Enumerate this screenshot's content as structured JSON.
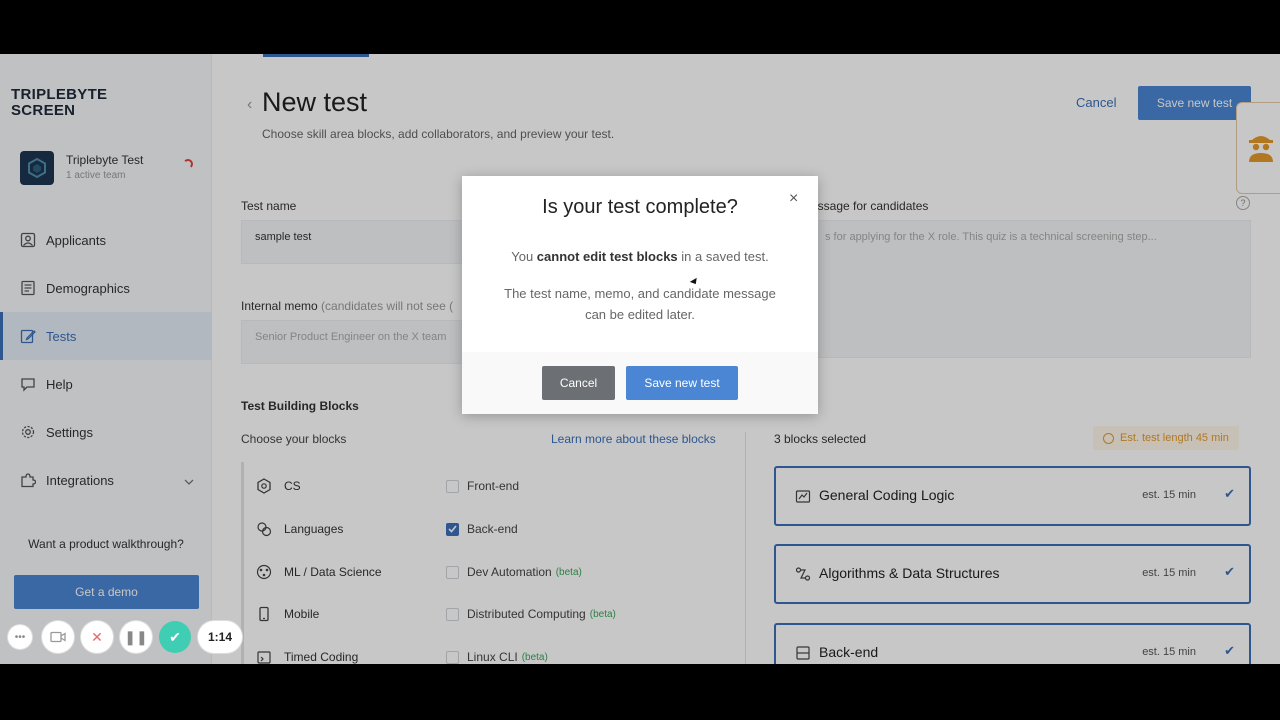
{
  "sidebar": {
    "brand_line1": "TRIPLEBYTE",
    "brand_line2": "SCREEN",
    "team_name": "Triplebyte Test",
    "team_sub": "1 active team",
    "items": [
      {
        "label": "Applicants",
        "icon": "person-icon"
      },
      {
        "label": "Demographics",
        "icon": "document-icon"
      },
      {
        "label": "Tests",
        "icon": "edit-icon",
        "active": true
      },
      {
        "label": "Help",
        "icon": "help-icon"
      },
      {
        "label": "Settings",
        "icon": "gear-icon"
      },
      {
        "label": "Integrations",
        "icon": "puzzle-icon"
      }
    ],
    "walkthrough": "Want a product walkthrough?",
    "demo_button": "Get a demo"
  },
  "header": {
    "title": "New test",
    "subtitle": "Choose skill area blocks, add collaborators, and preview your test.",
    "cancel": "Cancel",
    "save": "Save new test"
  },
  "form": {
    "test_name_label": "Test name",
    "test_name_value": "sample test",
    "memo_label": "Internal memo",
    "memo_note": "(candidates will not see (",
    "memo_placeholder": "Senior Product Engineer on the X team",
    "message_label": "essage for candidates",
    "message_placeholder": "s for applying for the X role. This quiz is a technical screening step..."
  },
  "blocks": {
    "title": "Test Building Blocks",
    "choose": "Choose your blocks",
    "learn_more": "Learn more about these blocks",
    "categories": [
      "CS",
      "Languages",
      "ML / Data Science",
      "Mobile",
      "Timed Coding"
    ],
    "options": [
      {
        "label": "Front-end",
        "checked": false,
        "beta": ""
      },
      {
        "label": "Back-end",
        "checked": true,
        "beta": ""
      },
      {
        "label": "Dev Automation",
        "checked": false,
        "beta": "(beta)"
      },
      {
        "label": "Distributed Computing",
        "checked": false,
        "beta": "(beta)"
      },
      {
        "label": "Linux CLI",
        "checked": false,
        "beta": "(beta)"
      }
    ],
    "selected_count": "3 blocks selected",
    "est_total": "Est. test length 45 min",
    "selected": [
      {
        "name": "General Coding Logic",
        "est": "est. 15 min"
      },
      {
        "name": "Algorithms & Data Structures",
        "est": "est. 15 min"
      },
      {
        "name": "Back-end",
        "est": "est. 15 min"
      }
    ]
  },
  "modal": {
    "title": "Is your test complete?",
    "close": "×",
    "p1_pre": "You",
    "p1_bold": "cannot edit test blocks",
    "p1_post": "in a saved test.",
    "p2": "The test name, memo, and candidate message can be edited later.",
    "cancel": "Cancel",
    "save": "Save new test"
  },
  "recorder": {
    "timer": "1:14"
  },
  "colors": {
    "accent": "#4a86d4",
    "link": "#3b6fb8",
    "recorder_green": "#3fcdb3"
  }
}
